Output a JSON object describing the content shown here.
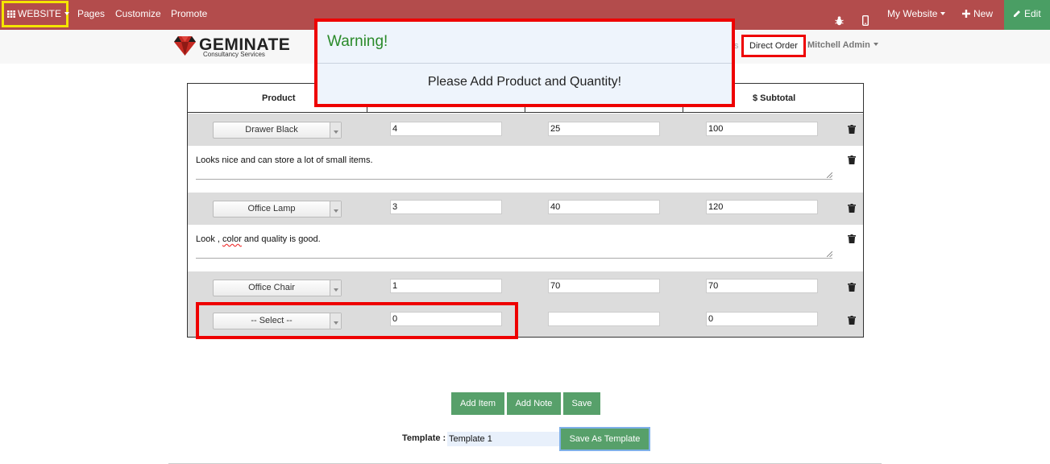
{
  "topbar": {
    "apps_label": "WEBSITE",
    "pages": "Pages",
    "customize": "Customize",
    "promote": "Promote",
    "my_website": "My Website",
    "new": "New",
    "edit": "Edit"
  },
  "brand": {
    "name": "GEMINATE",
    "tagline": "Consultancy Services"
  },
  "nav": {
    "partial_text": "s",
    "direct_order": "Direct Order",
    "user": "Mitchell Admin"
  },
  "warning": {
    "title": "Warning!",
    "message": "Please Add Product and Quantity!"
  },
  "table": {
    "headers": [
      "Product",
      "$ Subtotal"
    ],
    "rows": [
      {
        "product": "Drawer Black",
        "qty": "4",
        "price": "25",
        "subtotal": "100",
        "note": "Looks nice and can  store a  lot of small items."
      },
      {
        "product": "Office Lamp",
        "qty": "3",
        "price": "40",
        "subtotal": "120",
        "note_pre": "Look , ",
        "note_spell": "color",
        "note_post": " and quality is good."
      },
      {
        "product": "Office Chair",
        "qty": "1",
        "price": "70",
        "subtotal": "70"
      },
      {
        "product": "-- Select --",
        "qty": "0",
        "price": "",
        "subtotal": "0"
      }
    ]
  },
  "actions": {
    "add_item": "Add Item",
    "add_note": "Add Note",
    "save": "Save",
    "template_label": "Template :",
    "template_value": "Template 1",
    "save_as_template": "Save As Template"
  },
  "colors": {
    "topbar": "#b34c4c",
    "edit_button": "#4a9e64",
    "action_button": "#57a06a",
    "warning_title": "#2a8a2a",
    "highlight_red": "#ee0000",
    "highlight_yellow": "#f5e400"
  },
  "icons": [
    "grid-icon",
    "bug-icon",
    "mobile-icon",
    "plus-icon",
    "pencil-icon",
    "trash-icon",
    "diamond-logo-icon"
  ]
}
